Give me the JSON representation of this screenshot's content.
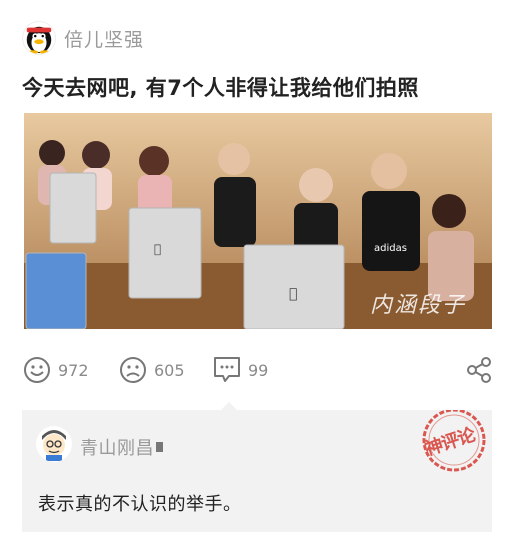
{
  "post": {
    "author": "倍儿坚强",
    "title": "今天去网吧, 有7个人非得让我给他们拍照",
    "image_watermark": "内涵段子"
  },
  "actions": {
    "like_count": "972",
    "dislike_count": "605",
    "comment_count": "99"
  },
  "top_comment": {
    "username": "青山刚昌",
    "text": "表示真的不认识的举手。",
    "stamp": "神评论"
  },
  "colors": {
    "stamp_red": "#d9574f",
    "comment_bg": "#f2f2f2",
    "muted_text": "#9a9a9a"
  }
}
